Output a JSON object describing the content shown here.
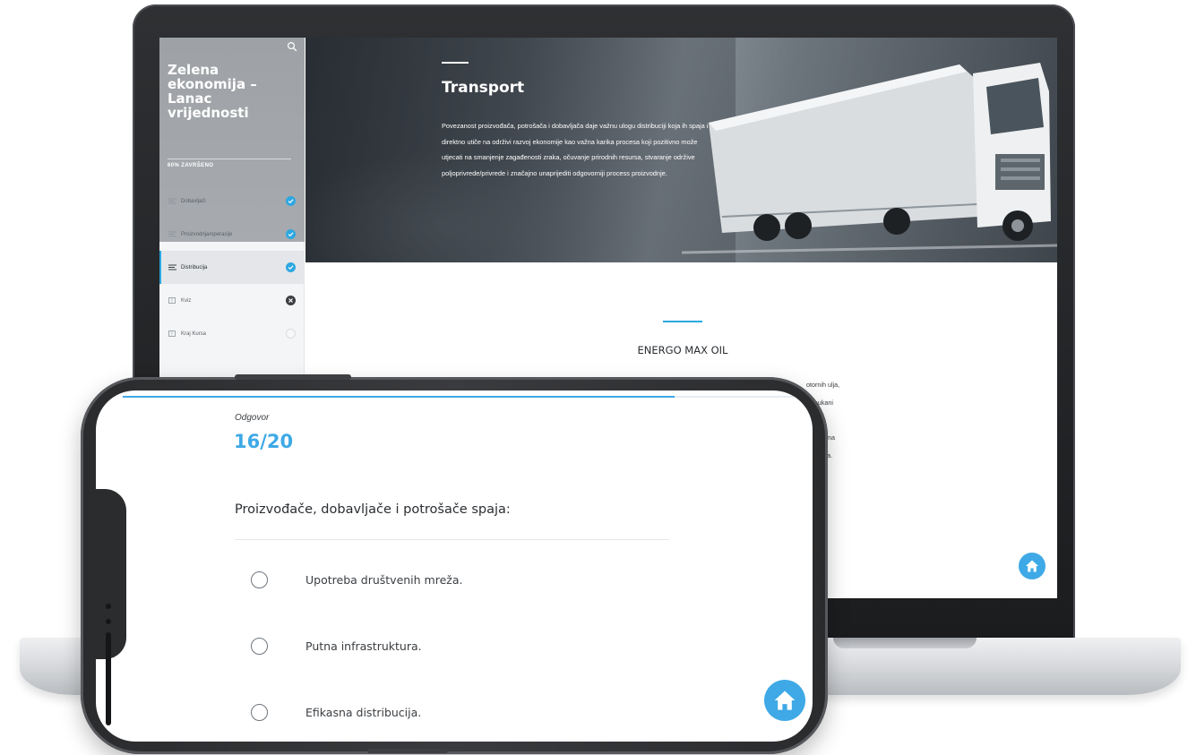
{
  "laptop": {
    "sidebar": {
      "course_title": "Zelena ekonomija – Lanac vrijednosti",
      "progress_label": "60% ZAVRŠENO",
      "progress_value": 0.6,
      "items": [
        {
          "label": "Dobavljači",
          "status": "completed"
        },
        {
          "label": "Proizvodnja/operacije",
          "status": "completed"
        },
        {
          "label": "Distribucija",
          "status": "completed",
          "active": true
        },
        {
          "label": "Kviz",
          "status": "failed"
        },
        {
          "label": "Kraj Kursa",
          "status": "not-started"
        }
      ]
    },
    "hero": {
      "title": "Transport",
      "text": "Povezanost proizvođača, potrošača i dobavljača daje važnu ulogu distribuciji koja ih spaja i direktno utiče na održivi razvoj ekonomije kao važna karika procesa koji pozitivno može utjecati na smanjenje zagađenosti zraka, očuvanje prirodnih resursa, stvaranje održive poljoprivrede/privrede i značajno unaprijediti odgovorniji process proizvodnje."
    },
    "section": {
      "title": "ENERGO MAX OIL",
      "visible_fragments": [
        "otornih ulja,",
        "Ponukani",
        "irskim",
        "nje prema",
        "i baterija."
      ]
    }
  },
  "phone": {
    "progress_value": 0.8,
    "answer_label": "Odgovor",
    "counter": "16/20",
    "question": "Proizvođače, dobavljače i potrošače spaja:",
    "options": [
      "Upotreba društvenih mreža.",
      "Putna infrastruktura.",
      "Efikasna distribucija."
    ]
  },
  "icons": {
    "search": "search-icon",
    "lesson": "lines-icon",
    "quiz": "quiz-icon",
    "completed": "check-circle-icon",
    "failed": "x-circle-icon",
    "home": "home-icon"
  },
  "colors": {
    "accent": "#3ea9e6",
    "sidebar_header": "#a3a7ab",
    "dark_status": "#3b3d40"
  }
}
